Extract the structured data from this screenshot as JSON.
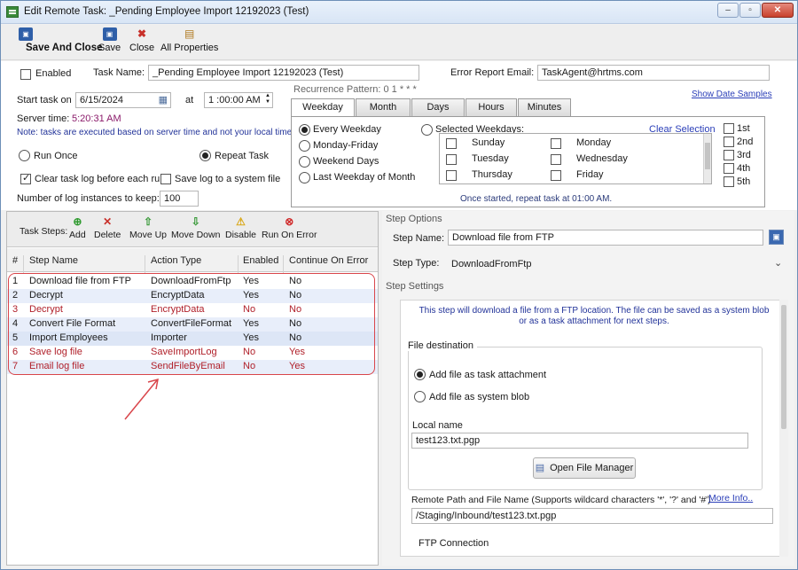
{
  "window": {
    "title": "Edit Remote Task: _Pending Employee Import 12192023 (Test)",
    "controls": {
      "minimize": "–",
      "maximize": "▫",
      "close": "✕"
    }
  },
  "toolbar": {
    "save_and_close": "Save And Close",
    "save": "Save",
    "close": "Close",
    "all_properties": "All Properties"
  },
  "task": {
    "enabled_label": "Enabled",
    "enabled": false,
    "task_name_label": "Task Name:",
    "task_name": "_Pending Employee Import 12192023 (Test)",
    "error_email_label": "Error Report Email:",
    "error_email": "TaskAgent@hrtms.com",
    "start_label": "Start task on",
    "start_date": "6/15/2024",
    "at_label": "at",
    "start_time": "1 :00:00 AM",
    "server_time_label": "Server time:",
    "server_time": "5:20:31 AM",
    "note": "Note: tasks are executed based on server time and not your local time!",
    "run_once": "Run Once",
    "repeat_task": "Repeat Task",
    "clear_log": "Clear task log before each run",
    "save_log": "Save log to a system file",
    "log_instances_label": "Number of log instances to keep:",
    "log_instances": "100"
  },
  "recurrence": {
    "label": "Recurrence Pattern: 0 1 * * *",
    "show_samples": "Show Date Samples",
    "tabs": [
      "Weekday",
      "Month",
      "Days",
      "Hours",
      "Minutes"
    ],
    "active_tab": "Weekday",
    "options": [
      "Every Weekday",
      "Monday-Friday",
      "Weekend Days",
      "Last Weekday of Month"
    ],
    "selected_weekdays": "Selected Weekdays:",
    "clear_selection": "Clear Selection",
    "weekdays_col1": [
      "Sunday",
      "Tuesday",
      "Thursday"
    ],
    "weekdays_col2": [
      "Monday",
      "Wednesday",
      "Friday"
    ],
    "ordinals": [
      "1st",
      "2nd",
      "3rd",
      "4th",
      "5th"
    ],
    "summary": "Once started, repeat task at 01:00 AM."
  },
  "steps_toolbar": {
    "label": "Task Steps:",
    "add": "Add",
    "delete": "Delete",
    "move_up": "Move Up",
    "move_down": "Move Down",
    "disable": "Disable",
    "run_on_error": "Run On Error"
  },
  "grid": {
    "headers": {
      "num": "#",
      "step": "Step Name",
      "action": "Action Type",
      "enabled": "Enabled",
      "continue": "Continue On Error"
    },
    "rows": [
      {
        "num": "1",
        "step": "Download file from FTP",
        "action": "DownloadFromFtp",
        "enabled": "Yes",
        "continue": "No"
      },
      {
        "num": "2",
        "step": "Decrypt",
        "action": "EncryptData",
        "enabled": "Yes",
        "continue": "No"
      },
      {
        "num": "3",
        "step": "Decrypt",
        "action": "EncryptData",
        "enabled": "No",
        "continue": "No"
      },
      {
        "num": "4",
        "step": "Convert File Format",
        "action": "ConvertFileFormat",
        "enabled": "Yes",
        "continue": "No"
      },
      {
        "num": "5",
        "step": "Import Employees",
        "action": "Importer",
        "enabled": "Yes",
        "continue": "No"
      },
      {
        "num": "6",
        "step": "Save log file",
        "action": "SaveImportLog",
        "enabled": "No",
        "continue": "Yes"
      },
      {
        "num": "7",
        "step": "Email log file",
        "action": "SendFileByEmail",
        "enabled": "No",
        "continue": "Yes"
      }
    ]
  },
  "step_options": {
    "title": "Step Options",
    "name_label": "Step Name:",
    "name": "Download file from FTP",
    "type_label": "Step Type:",
    "type": "DownloadFromFtp"
  },
  "step_settings": {
    "title": "Step Settings",
    "description": "This step will download a file from a FTP location. The file can be saved as a system blob or as a task attachment for next steps.",
    "file_destination": "File destination",
    "as_attachment": "Add file as task attachment",
    "as_blob": "Add file as system blob",
    "local_name_label": "Local name",
    "local_name": "test123.txt.pgp",
    "open_file_manager": "Open File Manager",
    "remote_path_label": "Remote Path and File Name (Supports wildcard characters '*', '?' and '#')",
    "more_info": "More Info..",
    "remote_path": "/Staging/Inbound/test123.txt.pgp",
    "ftp_connection": "FTP Connection"
  },
  "colors": {
    "accent_link": "#2a3eb8",
    "disabled_row_text": "#b0202a",
    "annotation": "#d9464b"
  }
}
